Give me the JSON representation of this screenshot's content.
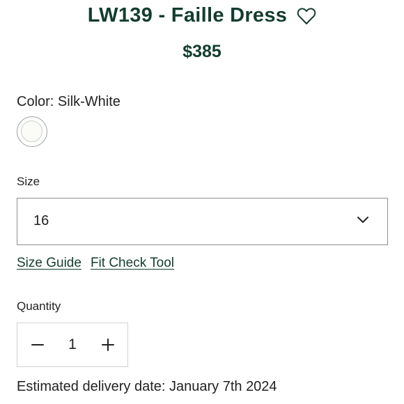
{
  "product": {
    "title": "LW139 - Faille Dress",
    "price": "$385",
    "favorite_icon": "heart-outline-icon"
  },
  "color": {
    "label": "Color: Silk-White",
    "swatch_color": "#fbfbf8"
  },
  "size": {
    "label": "Size",
    "selected": "16",
    "dropdown_icon": "chevron-down-icon"
  },
  "links": {
    "size_guide": "Size Guide",
    "fit_check": "Fit Check Tool"
  },
  "quantity": {
    "label": "Quantity",
    "value": "1",
    "decrement_icon": "minus-icon",
    "increment_icon": "plus-icon"
  },
  "delivery": {
    "text": "Estimated delivery date: January 7th 2024"
  },
  "colors": {
    "brand_green": "#133d2e",
    "border_gray": "#8e8e8e"
  }
}
